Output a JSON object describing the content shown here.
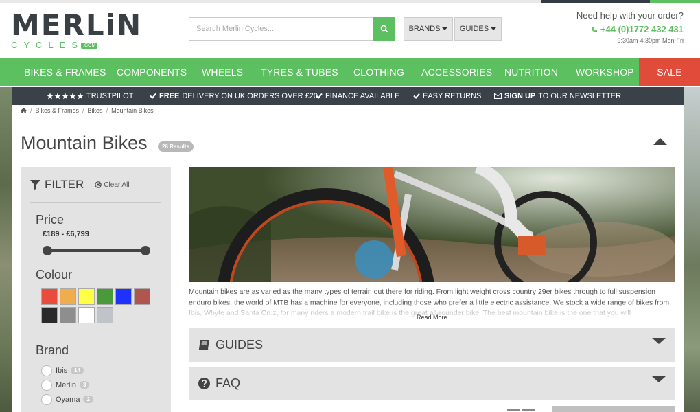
{
  "header": {
    "logo_text": "MERLiN",
    "logo_sub": "CYCLES",
    "logo_com": ".COM",
    "search_placeholder": "Search Merlin Cycles...",
    "brands_label": "BRANDS",
    "guides_label": "GUIDES",
    "help_question": "Need help with your order?",
    "phone": "+44 (0)1772 432 431",
    "hours": "9:30am-4:30pm Mon-Fri"
  },
  "nav": {
    "items": [
      "BIKES & FRAMES",
      "COMPONENTS",
      "WHEELS",
      "TYRES & TUBES",
      "CLOTHING",
      "ACCESSORIES",
      "NUTRITION",
      "WORKSHOP"
    ],
    "sale": "SALE"
  },
  "usp": {
    "trustpilot": "TRUSTPILOT",
    "delivery_bold": "FREE",
    "delivery_rest": "DELIVERY ON UK ORDERS OVER £20",
    "finance": "FINANCE AVAILABLE",
    "returns": "EASY RETURNS",
    "signup_bold": "SIGN UP",
    "signup_rest": "TO OUR NEWSLETTER"
  },
  "breadcrumb": [
    "Bikes & Frames",
    "Bikes",
    "Mountain Bikes"
  ],
  "page": {
    "title": "Mountain Bikes",
    "results": "26 Results"
  },
  "filter": {
    "title": "FILTER",
    "clear": "Clear All",
    "price_heading": "Price",
    "price_range": "£189 - £6,799",
    "price_min_pos": 0,
    "price_max_pos": 1,
    "colour_heading": "Colour",
    "colours": [
      "#e84c3d",
      "#f0ad4e",
      "#ffff44",
      "#4a9a3a",
      "#1e32ff",
      "#b0564e",
      "#2a2a2a",
      "#8e8e8e",
      "#ffffff",
      "#c0c4c8"
    ],
    "brand_heading": "Brand",
    "brands": [
      {
        "name": "Ibis",
        "count": "14"
      },
      {
        "name": "Merlin",
        "count": "3"
      },
      {
        "name": "Oyama",
        "count": "2"
      }
    ]
  },
  "description": {
    "text": "Mountain bikes are as varied as the many types of terrain out there for riding. From light weight cross country 29er bikes through to full suspension enduro bikes, the world of MTB has a machine for everyone, including those who prefer a little electric assistance. We stock a wide range of bikes from Ibis, Whyte and Santa Cruz, for many riders a modern trail bike is the great all-rounder bike. The best mountain bike is the one that you will",
    "read_more": "Read More"
  },
  "accordions": {
    "guides": "GUIDES",
    "faq": "FAQ"
  }
}
